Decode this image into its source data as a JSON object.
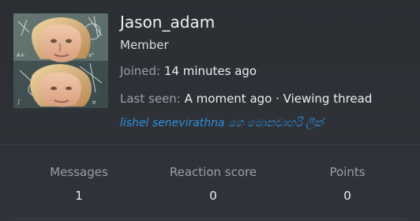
{
  "profile": {
    "username": "Jason_adam",
    "role": "Member",
    "joined_label": "Joined:",
    "joined_value": "14 minutes ago",
    "last_seen_label": "Last seen:",
    "last_seen_value": "A moment ago · Viewing thread",
    "signature": "lishel senevirathna ගෙ මොනවාහරි ලීක්"
  },
  "stats": {
    "messages_label": "Messages",
    "messages_value": "1",
    "reaction_label": "Reaction score",
    "reaction_value": "0",
    "points_label": "Points",
    "points_value": "0"
  },
  "colors": {
    "background": "#2d3035",
    "signature_link": "#2f8fd8",
    "muted_text": "#9aa0a8",
    "primary_text": "#eceef0"
  },
  "icons": {
    "avatar": "user-avatar-image"
  }
}
